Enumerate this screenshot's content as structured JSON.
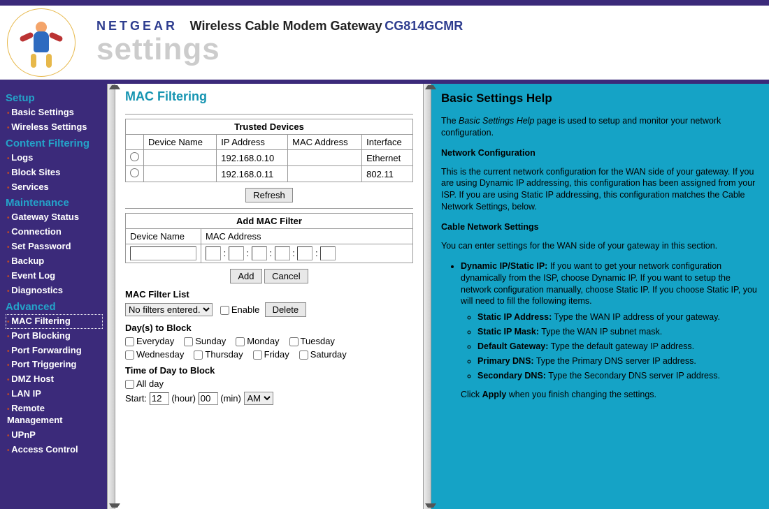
{
  "header": {
    "brand": "NETGEAR",
    "product": "Wireless Cable Modem Gateway",
    "model": "CG814GCMR",
    "subtitle": "settings"
  },
  "sidebar": [
    {
      "type": "section",
      "label": "Setup"
    },
    {
      "type": "item",
      "label": "Basic Settings"
    },
    {
      "type": "item",
      "label": "Wireless Settings"
    },
    {
      "type": "section",
      "label": "Content Filtering"
    },
    {
      "type": "item",
      "label": "Logs"
    },
    {
      "type": "item",
      "label": "Block Sites"
    },
    {
      "type": "item",
      "label": "Services"
    },
    {
      "type": "section",
      "label": "Maintenance"
    },
    {
      "type": "item",
      "label": "Gateway Status"
    },
    {
      "type": "item",
      "label": "Connection"
    },
    {
      "type": "item",
      "label": "Set Password"
    },
    {
      "type": "item",
      "label": "Backup"
    },
    {
      "type": "item",
      "label": "Event Log"
    },
    {
      "type": "item",
      "label": "Diagnostics"
    },
    {
      "type": "section",
      "label": "Advanced"
    },
    {
      "type": "item",
      "label": "MAC Filtering",
      "active": true
    },
    {
      "type": "item",
      "label": "Port Blocking"
    },
    {
      "type": "item",
      "label": "Port Forwarding"
    },
    {
      "type": "item",
      "label": "Port Triggering"
    },
    {
      "type": "item",
      "label": "DMZ Host"
    },
    {
      "type": "item",
      "label": "LAN IP"
    },
    {
      "type": "item",
      "label": "Remote Management"
    },
    {
      "type": "item",
      "label": "UPnP"
    },
    {
      "type": "item",
      "label": "Access Control"
    }
  ],
  "main": {
    "title": "MAC Filtering",
    "trusted": {
      "title": "Trusted Devices",
      "headers": [
        "Device Name",
        "IP Address",
        "MAC Address",
        "Interface"
      ],
      "rows": [
        {
          "name": "",
          "ip": "192.168.0.10",
          "mac": "",
          "iface": "Ethernet"
        },
        {
          "name": "",
          "ip": "192.168.0.11",
          "mac": "",
          "iface": "802.11"
        }
      ],
      "refresh": "Refresh"
    },
    "addFilter": {
      "title": "Add MAC Filter",
      "headers": [
        "Device Name",
        "MAC Address"
      ],
      "add": "Add",
      "cancel": "Cancel"
    },
    "filterList": {
      "label": "MAC Filter List",
      "selected": "No filters entered.",
      "enable": "Enable",
      "delete": "Delete"
    },
    "days": {
      "label": "Day(s) to Block",
      "opts": [
        "Everyday",
        "Sunday",
        "Monday",
        "Tuesday",
        "Wednesday",
        "Thursday",
        "Friday",
        "Saturday"
      ]
    },
    "time": {
      "label": "Time of Day to Block",
      "allday": "All day",
      "startLabel": "Start:",
      "startHour": "12",
      "hourLabel": "(hour)",
      "startMin": "00",
      "minLabel": "(min)",
      "ampm": "AM"
    }
  },
  "help": {
    "title": "Basic Settings Help",
    "intro_a": "The ",
    "intro_i": "Basic Settings Help",
    "intro_b": " page is used to setup and monitor your network configuration.",
    "h_net": "Network Configuration",
    "p_net": "This is the current network configuration for the WAN side of your gateway. If you are using Dynamic IP addressing, this configuration has been assigned from your ISP. If you are using Static IP addressing, this configuration matches the Cable Network Settings, below.",
    "h_cable": "Cable Network Settings",
    "p_cable": "You can enter settings for the WAN side of your gateway in this section.",
    "li1_b": "Dynamic IP/Static IP:",
    "li1_t": " If you want to get your network configuration dynamically from the ISP, choose Dynamic IP. If you want to setup the network configuration manually, choose Static IP. If you choose Static IP, you will need to fill the following items.",
    "s1_b": "Static IP Address:",
    "s1_t": " Type the WAN IP address of your gateway.",
    "s2_b": "Static IP Mask:",
    "s2_t": " Type the WAN IP subnet mask.",
    "s3_b": "Default Gateway:",
    "s3_t": " Type the default gateway IP address.",
    "s4_b": "Primary DNS:",
    "s4_t": " Type the Primary DNS server IP address.",
    "s5_b": "Secondary DNS:",
    "s5_t": " Type the Secondary DNS server IP address.",
    "apply_a": "Click ",
    "apply_b": "Apply",
    "apply_c": " when you finish changing the settings."
  }
}
